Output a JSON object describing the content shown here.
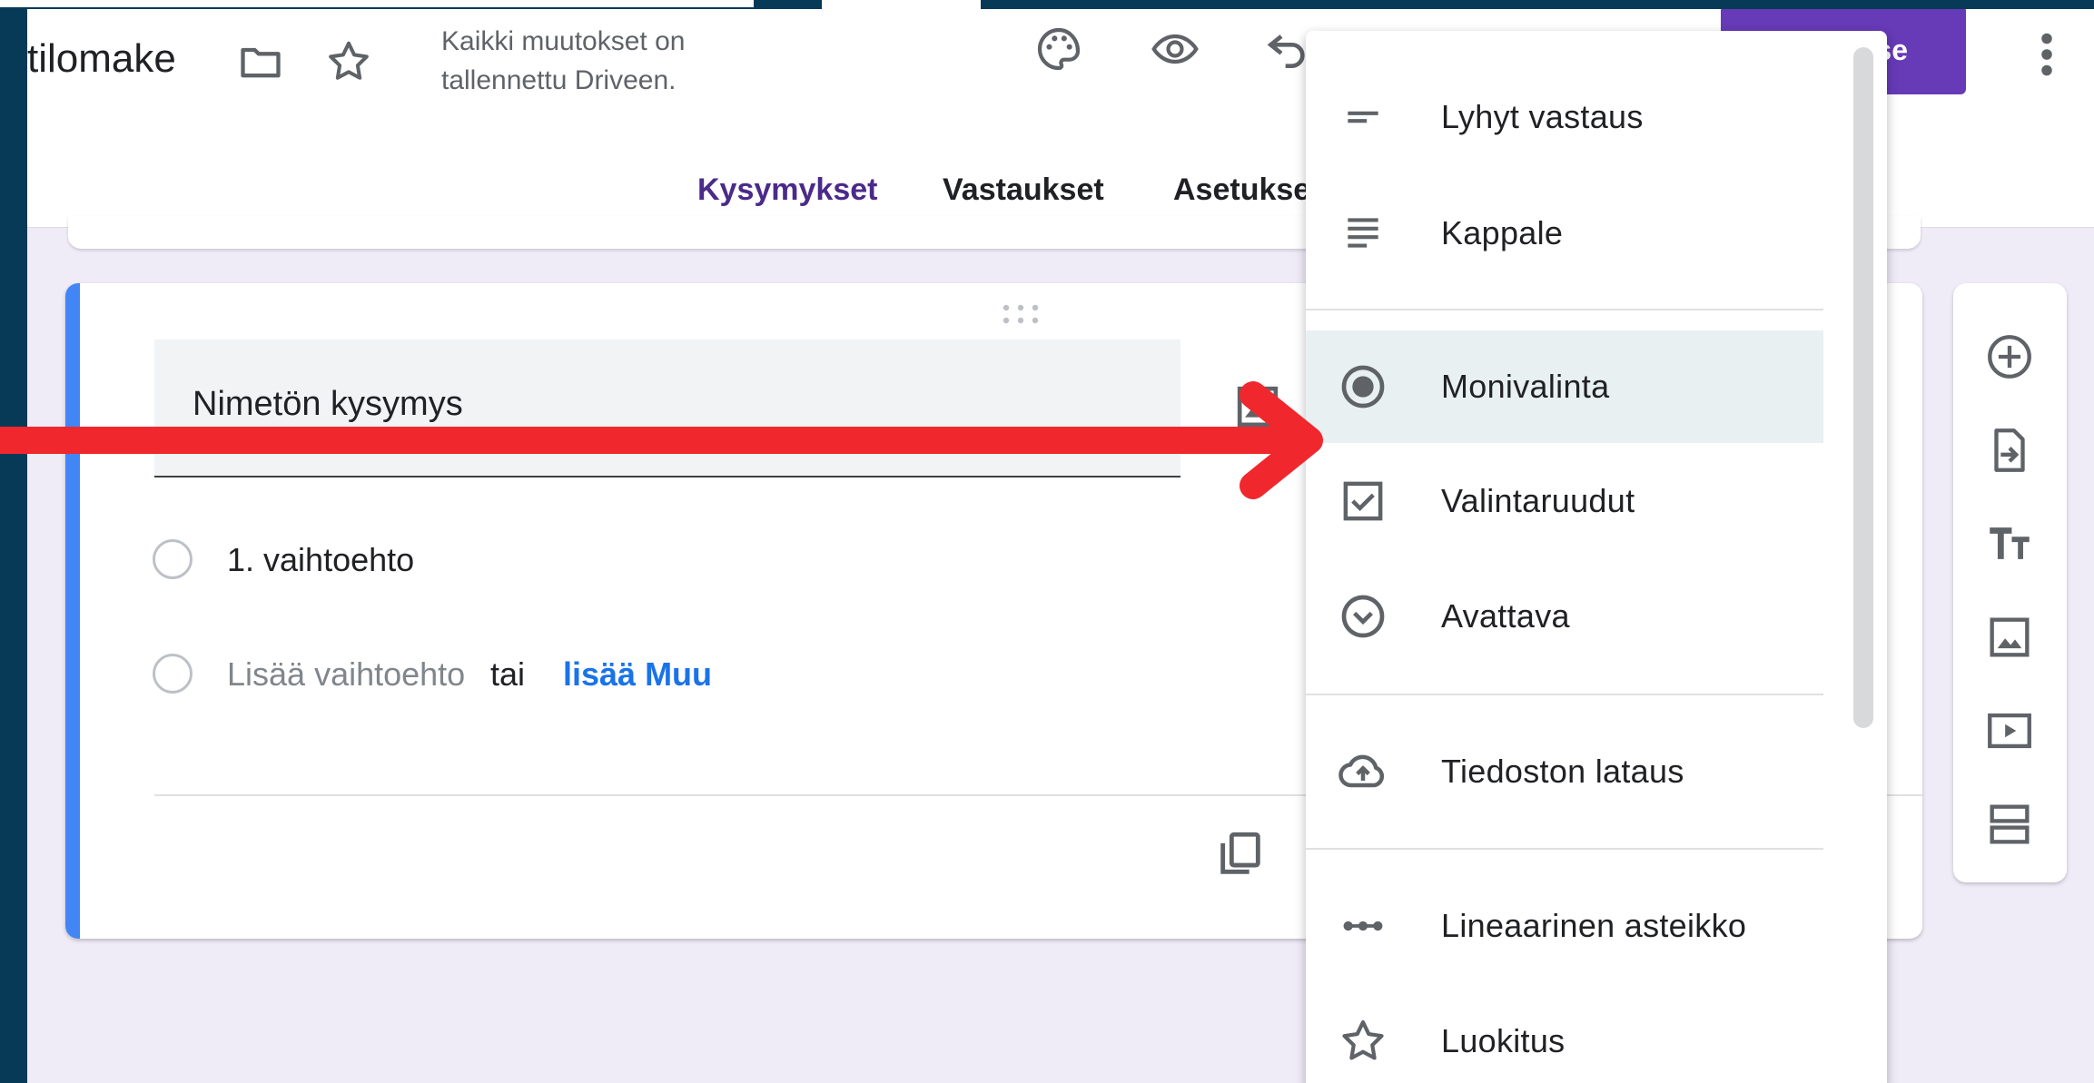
{
  "colors": {
    "brand": "#673ab7",
    "accent_blue": "#4285f4",
    "link": "#1a73e8",
    "arrow": "#f0282e",
    "backdrop": "#063a56"
  },
  "header": {
    "doc_title": "tilomake",
    "folder_icon": "folder-icon",
    "star_icon": "star-icon",
    "save_status_line1": "Kaikki muutokset on",
    "save_status_line2": "tallennettu Driveen.",
    "palette_icon": "palette-icon",
    "preview_icon": "eye-icon",
    "undo_icon": "undo-icon",
    "send_label": "ise",
    "more_icon": "more-vert-icon"
  },
  "tabs": [
    {
      "label": "Kysymykset",
      "active": true
    },
    {
      "label": "Vastaukset",
      "active": false
    },
    {
      "label": "Asetukse",
      "active": false
    }
  ],
  "question": {
    "title": "Nimetön kysymys",
    "option1": "1. vaihtoehto",
    "add_option": "Lisää vaihtoehto",
    "or_text": "tai",
    "add_other": "lisää Muu"
  },
  "type_menu": {
    "items": [
      {
        "label": "Lyhyt vastaus",
        "icon": "short-answer-icon"
      },
      {
        "label": "Kappale",
        "icon": "paragraph-icon"
      },
      {
        "label": "Monivalinta",
        "icon": "radio-button-icon",
        "selected": true
      },
      {
        "label": "Valintaruudut",
        "icon": "checkbox-icon"
      },
      {
        "label": "Avattava",
        "icon": "dropdown-icon"
      },
      {
        "label": "Tiedoston lataus",
        "icon": "cloud-upload-icon"
      },
      {
        "label": "Lineaarinen asteikko",
        "icon": "linear-scale-icon"
      },
      {
        "label": "Luokitus",
        "icon": "star-outline-icon"
      }
    ]
  },
  "sidebar": {
    "icons": [
      "add-question-icon",
      "import-questions-icon",
      "add-title-icon",
      "add-image-icon",
      "add-video-icon",
      "add-section-icon"
    ]
  }
}
